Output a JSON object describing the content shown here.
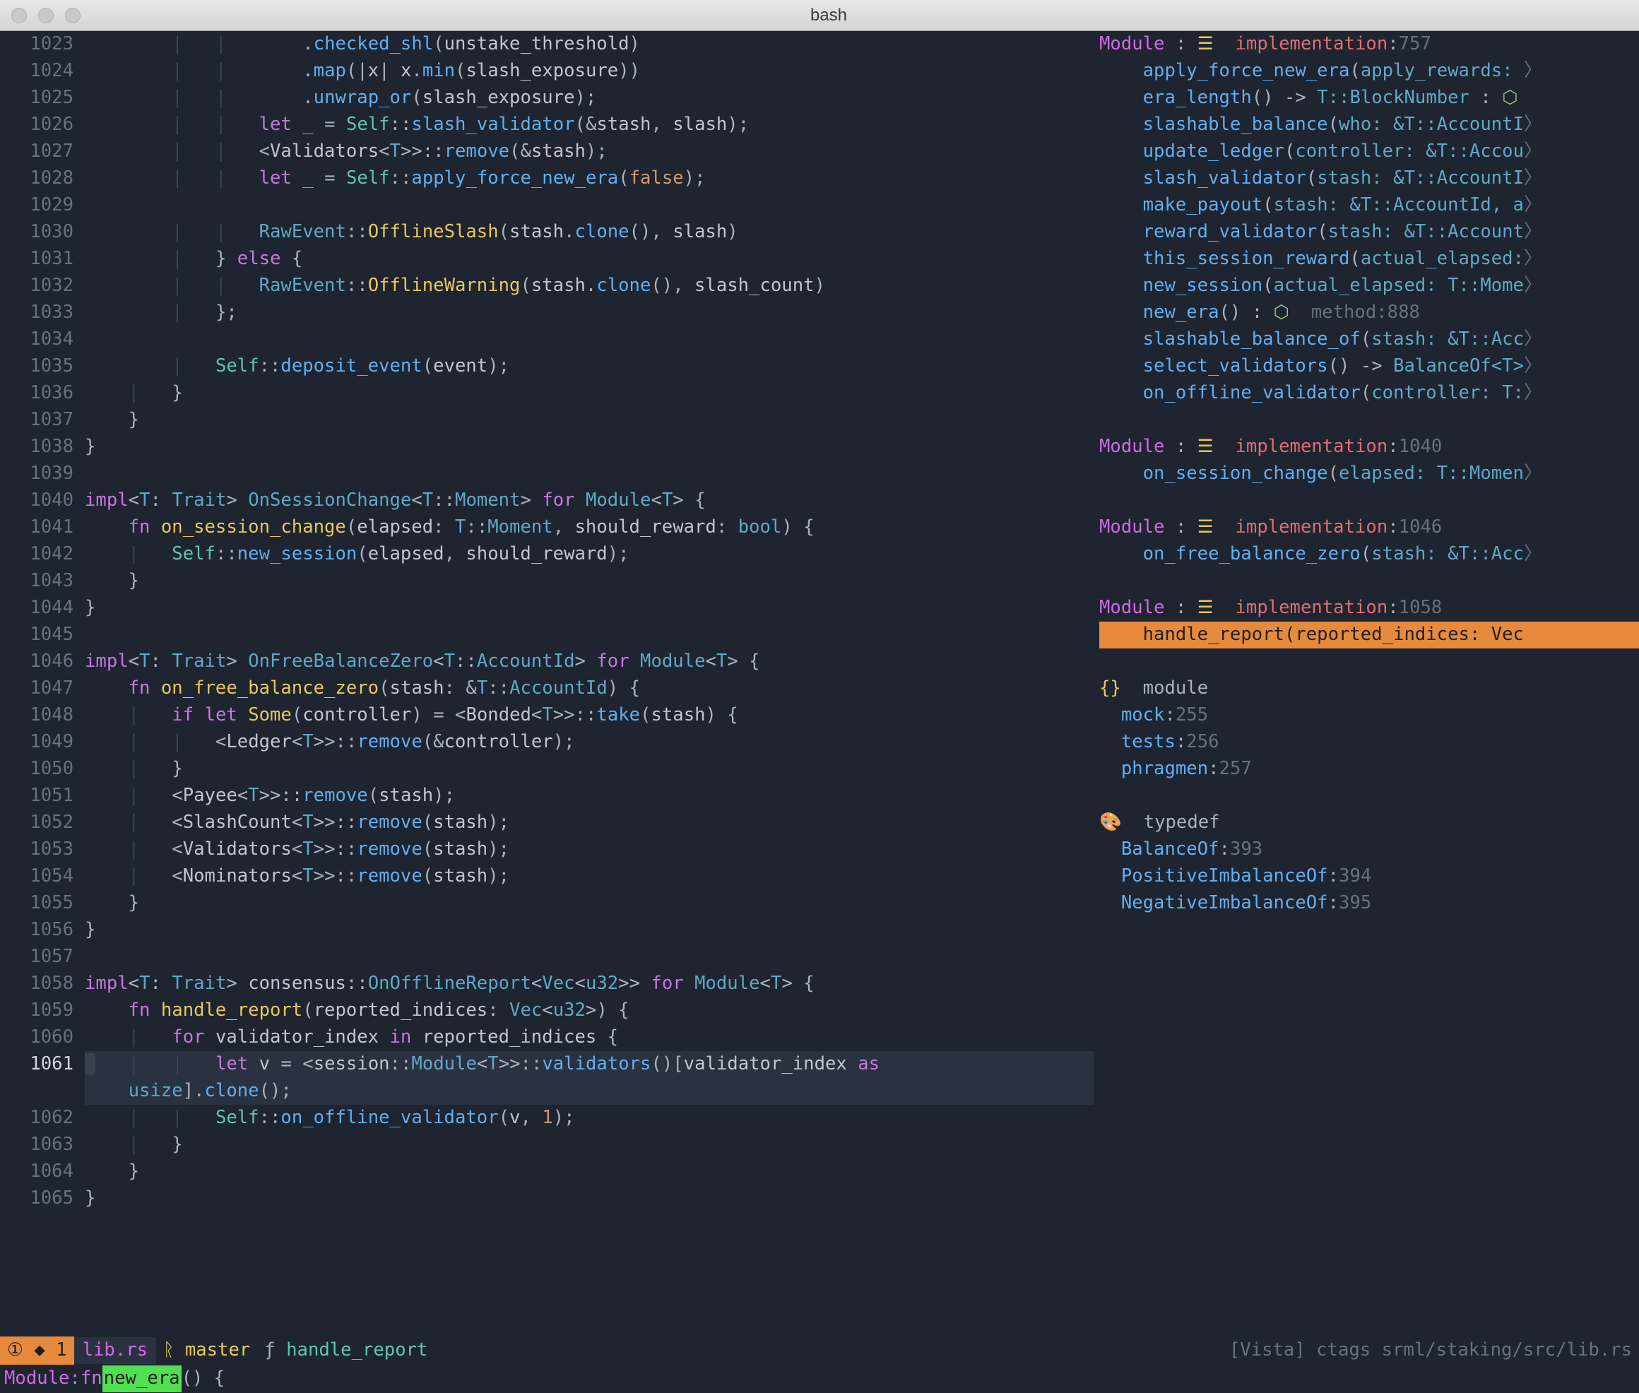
{
  "window": {
    "title": "bash"
  },
  "editor": {
    "current_line": 1061,
    "lines": [
      {
        "n": 1023,
        "html": "        <span class='pipe'>|</span>   <span class='pipe'>|</span>       <span class='pn'>.</span><span class='call'>checked_shl</span><span class='pn'>(</span>unstake_threshold<span class='pn'>)</span>"
      },
      {
        "n": 1024,
        "html": "        <span class='pipe'>|</span>   <span class='pipe'>|</span>       <span class='pn'>.</span><span class='call'>map</span><span class='pn'>(|</span>x<span class='pn'>|</span> x<span class='pn'>.</span><span class='call'>min</span><span class='pn'>(</span>slash_exposure<span class='pn'>))</span>"
      },
      {
        "n": 1025,
        "html": "        <span class='pipe'>|</span>   <span class='pipe'>|</span>       <span class='pn'>.</span><span class='call'>unwrap_or</span><span class='pn'>(</span>slash_exposure<span class='pn'>);</span>"
      },
      {
        "n": 1026,
        "html": "        <span class='pipe'>|</span>   <span class='pipe'>|</span>   <span class='kw'>let</span> <span class='kw'>_</span> <span class='op'>=</span> <span class='self'>Self</span><span class='pn'>::</span><span class='call'>slash_validator</span><span class='pn'>(&</span>stash<span class='pn'>,</span> slash<span class='pn'>);</span>"
      },
      {
        "n": 1027,
        "html": "        <span class='pipe'>|</span>   <span class='pipe'>|</span>   <span class='pn'>&lt;</span>Validators<span class='pn'>&lt;</span><span class='ty'>T</span><span class='pn'>&gt;&gt;::</span><span class='call'>remove</span><span class='pn'>(&</span>stash<span class='pn'>);</span>"
      },
      {
        "n": 1028,
        "html": "        <span class='pipe'>|</span>   <span class='pipe'>|</span>   <span class='kw'>let</span> <span class='kw'>_</span> <span class='op'>=</span> <span class='self'>Self</span><span class='pn'>::</span><span class='call'>apply_force_new_era</span><span class='pn'>(</span><span class='num'>false</span><span class='pn'>);</span>"
      },
      {
        "n": 1029,
        "html": ""
      },
      {
        "n": 1030,
        "html": "        <span class='pipe'>|</span>   <span class='pipe'>|</span>   <span class='ty'>RawEvent</span><span class='pn'>::</span><span class='fn'>OfflineSlash</span><span class='pn'>(</span>stash<span class='pn'>.</span><span class='call'>clone</span><span class='pn'>(),</span> slash<span class='pn'>)</span>"
      },
      {
        "n": 1031,
        "html": "        <span class='pipe'>|</span>   <span class='pn'>}</span> <span class='kw'>else</span> <span class='pn'>{</span>"
      },
      {
        "n": 1032,
        "html": "        <span class='pipe'>|</span>   <span class='pipe'>|</span>   <span class='ty'>RawEvent</span><span class='pn'>::</span><span class='fn'>OfflineWarning</span><span class='pn'>(</span>stash<span class='pn'>.</span><span class='call'>clone</span><span class='pn'>(),</span> slash_count<span class='pn'>)</span>"
      },
      {
        "n": 1033,
        "html": "        <span class='pipe'>|</span>   <span class='pn'>};</span>"
      },
      {
        "n": 1034,
        "html": ""
      },
      {
        "n": 1035,
        "html": "        <span class='pipe'>|</span>   <span class='self'>Self</span><span class='pn'>::</span><span class='call'>deposit_event</span><span class='pn'>(</span>event<span class='pn'>);</span>"
      },
      {
        "n": 1036,
        "html": "    <span class='pipe'>|</span>   <span class='pn'>}</span>"
      },
      {
        "n": 1037,
        "html": "    <span class='pn'>}</span>"
      },
      {
        "n": 1038,
        "html": "<span class='pn'>}</span>"
      },
      {
        "n": 1039,
        "html": ""
      },
      {
        "n": 1040,
        "html": "<span class='kw'>impl</span><span class='pn'>&lt;</span><span class='ty'>T</span><span class='pn'>:</span> <span class='ty'>Trait</span><span class='pn'>&gt;</span> <span class='ty'>OnSessionChange</span><span class='pn'>&lt;</span><span class='ty'>T</span><span class='pn'>::</span><span class='ty'>Moment</span><span class='pn'>&gt;</span> <span class='kw'>for</span> <span class='ty'>Module</span><span class='pn'>&lt;</span><span class='ty'>T</span><span class='pn'>&gt;</span> <span class='pn'>{</span>"
      },
      {
        "n": 1041,
        "html": "    <span class='kw'>fn</span> <span class='fn'>on_session_change</span><span class='pn'>(</span>elapsed<span class='pn'>:</span> <span class='ty'>T</span><span class='pn'>::</span><span class='ty'>Moment</span><span class='pn'>,</span> should_reward<span class='pn'>:</span> <span class='ty'>bool</span><span class='pn'>)</span> <span class='pn'>{</span>"
      },
      {
        "n": 1042,
        "html": "    <span class='pipe'>|</span>   <span class='self'>Self</span><span class='pn'>::</span><span class='call'>new_session</span><span class='pn'>(</span>elapsed<span class='pn'>,</span> should_reward<span class='pn'>);</span>"
      },
      {
        "n": 1043,
        "html": "    <span class='pn'>}</span>"
      },
      {
        "n": 1044,
        "html": "<span class='pn'>}</span>"
      },
      {
        "n": 1045,
        "html": ""
      },
      {
        "n": 1046,
        "html": "<span class='kw'>impl</span><span class='pn'>&lt;</span><span class='ty'>T</span><span class='pn'>:</span> <span class='ty'>Trait</span><span class='pn'>&gt;</span> <span class='ty'>OnFreeBalanceZero</span><span class='pn'>&lt;</span><span class='ty'>T</span><span class='pn'>::</span><span class='ty'>AccountId</span><span class='pn'>&gt;</span> <span class='kw'>for</span> <span class='ty'>Module</span><span class='pn'>&lt;</span><span class='ty'>T</span><span class='pn'>&gt;</span> <span class='pn'>{</span>"
      },
      {
        "n": 1047,
        "html": "    <span class='kw'>fn</span> <span class='fn'>on_free_balance_zero</span><span class='pn'>(</span>stash<span class='pn'>:</span> <span class='pn'>&</span><span class='ty'>T</span><span class='pn'>::</span><span class='ty'>AccountId</span><span class='pn'>)</span> <span class='pn'>{</span>"
      },
      {
        "n": 1048,
        "html": "    <span class='pipe'>|</span>   <span class='kw'>if</span> <span class='kw'>let</span> <span class='fn'>Some</span><span class='pn'>(</span>controller<span class='pn'>)</span> <span class='op'>=</span> <span class='pn'>&lt;</span>Bonded<span class='pn'>&lt;</span><span class='ty'>T</span><span class='pn'>&gt;&gt;::</span><span class='call'>take</span><span class='pn'>(</span>stash<span class='pn'>)</span> <span class='pn'>{</span>"
      },
      {
        "n": 1049,
        "html": "    <span class='pipe'>|</span>   <span class='pipe'>|</span>   <span class='pn'>&lt;</span>Ledger<span class='pn'>&lt;</span><span class='ty'>T</span><span class='pn'>&gt;&gt;::</span><span class='call'>remove</span><span class='pn'>(&</span>controller<span class='pn'>);</span>"
      },
      {
        "n": 1050,
        "html": "    <span class='pipe'>|</span>   <span class='pn'>}</span>"
      },
      {
        "n": 1051,
        "html": "    <span class='pipe'>|</span>   <span class='pn'>&lt;</span>Payee<span class='pn'>&lt;</span><span class='ty'>T</span><span class='pn'>&gt;&gt;::</span><span class='call'>remove</span><span class='pn'>(</span>stash<span class='pn'>);</span>"
      },
      {
        "n": 1052,
        "html": "    <span class='pipe'>|</span>   <span class='pn'>&lt;</span>SlashCount<span class='pn'>&lt;</span><span class='ty'>T</span><span class='pn'>&gt;&gt;::</span><span class='call'>remove</span><span class='pn'>(</span>stash<span class='pn'>);</span>"
      },
      {
        "n": 1053,
        "html": "    <span class='pipe'>|</span>   <span class='pn'>&lt;</span>Validators<span class='pn'>&lt;</span><span class='ty'>T</span><span class='pn'>&gt;&gt;::</span><span class='call'>remove</span><span class='pn'>(</span>stash<span class='pn'>);</span>"
      },
      {
        "n": 1054,
        "html": "    <span class='pipe'>|</span>   <span class='pn'>&lt;</span>Nominators<span class='pn'>&lt;</span><span class='ty'>T</span><span class='pn'>&gt;&gt;::</span><span class='call'>remove</span><span class='pn'>(</span>stash<span class='pn'>);</span>"
      },
      {
        "n": 1055,
        "html": "    <span class='pn'>}</span>"
      },
      {
        "n": 1056,
        "html": "<span class='pn'>}</span>"
      },
      {
        "n": 1057,
        "html": ""
      },
      {
        "n": 1058,
        "html": "<span class='kw'>impl</span><span class='pn'>&lt;</span><span class='ty'>T</span><span class='pn'>:</span> <span class='ty'>Trait</span><span class='pn'>&gt;</span> consensus<span class='pn'>::</span><span class='ty'>OnOfflineReport</span><span class='pn'>&lt;</span><span class='ty'>Vec</span><span class='pn'>&lt;</span><span class='ty'>u32</span><span class='pn'>&gt;&gt;</span> <span class='kw'>for</span> <span class='ty'>Module</span><span class='pn'>&lt;</span><span class='ty'>T</span><span class='pn'>&gt;</span> <span class='pn'>{</span>"
      },
      {
        "n": 1059,
        "html": "    <span class='kw'>fn</span> <span class='fn'>handle_report</span><span class='pn'>(</span>reported_indices<span class='pn'>:</span> <span class='ty'>Vec</span><span class='pn'>&lt;</span><span class='ty'>u32</span><span class='pn'>&gt;)</span> <span class='pn'>{</span>"
      },
      {
        "n": 1060,
        "html": "    <span class='pipe'>|</span>   <span class='kw'>for</span> validator_index <span class='kw'>in</span> reported_indices <span class='pn'>{</span>"
      },
      {
        "n": 1061,
        "html": "<span style='background:#3a4150;'> </span>   <span class='pipe'>|</span>   <span class='pipe'>|</span>   <span class='kw'>let</span> v <span class='op'>=</span> <span class='pn'>&lt;</span>session<span class='pn'>::</span><span class='ty'>Module</span><span class='pn'>&lt;</span><span class='ty'>T</span><span class='pn'>&gt;&gt;::</span><span class='call'>validators</span><span class='pn'>()[</span>validator_index <span class='kw'>as</span>",
        "hl": true
      },
      {
        "n": 0,
        "html": "    <span class='ty'>usize</span><span class='pn'>].</span><span class='call'>clone</span><span class='pn'>();</span>",
        "hl": true,
        "hide_ln": true
      },
      {
        "n": 1062,
        "html": "    <span class='pipe'>|</span>   <span class='pipe'>|</span>   <span class='self'>Self</span><span class='pn'>::</span><span class='call'>on_offline_validator</span><span class='pn'>(</span>v<span class='pn'>,</span> <span class='num'>1</span><span class='pn'>);</span>"
      },
      {
        "n": 1063,
        "html": "    <span class='pipe'>|</span>   <span class='pn'>}</span>"
      },
      {
        "n": 1064,
        "html": "    <span class='pn'>}</span>"
      },
      {
        "n": 1065,
        "html": "<span class='pn'>}</span>"
      }
    ]
  },
  "outline": {
    "groups": [
      {
        "header_html": "<span class='mg'>Module</span> <span class='pn'>:</span> <span class='fn'>☰</span>  <span class='red'>implementation</span><span class='pn'>:</span><span class='cm'>757</span>",
        "items": [
          {
            "html": "    <span class='call'>apply_force_new_era</span><span class='pn'>(</span><span class='ty'>apply_rewards:</span> <span class='cm'>〉</span>"
          },
          {
            "html": "    <span class='call'>era_length</span><span class='pn'>()</span> <span class='pn'>-&gt;</span> <span class='ty'>T::BlockNumber</span> <span class='pn'>:</span> <span class='green2'>⬡</span>"
          },
          {
            "html": "    <span class='call'>slashable_balance</span><span class='pn'>(</span><span class='ty'>who: &T::AccountI</span><span class='cm'>〉</span>"
          },
          {
            "html": "    <span class='call'>update_ledger</span><span class='pn'>(</span><span class='ty'>controller: &T::Accou</span><span class='cm'>〉</span>"
          },
          {
            "html": "    <span class='call'>slash_validator</span><span class='pn'>(</span><span class='ty'>stash: &T::AccountI</span><span class='cm'>〉</span>"
          },
          {
            "html": "    <span class='call'>make_payout</span><span class='pn'>(</span><span class='ty'>stash: &T::AccountId, a</span><span class='cm'>〉</span>"
          },
          {
            "html": "    <span class='call'>reward_validator</span><span class='pn'>(</span><span class='ty'>stash: &T::Account</span><span class='cm'>〉</span>"
          },
          {
            "html": "    <span class='call'>this_session_reward</span><span class='pn'>(</span><span class='ty'>actual_elapsed:</span><span class='cm'>〉</span>"
          },
          {
            "html": "    <span class='call'>new_session</span><span class='pn'>(</span><span class='ty'>actual_elapsed: T::Mome</span><span class='cm'>〉</span>"
          },
          {
            "html": "    <span class='call'>new_era</span><span class='pn'>()</span> <span class='pn'>:</span> <span class='green2'>⬡</span>  <span class='cm'>method:</span><span class='cm'>888</span>"
          },
          {
            "html": "    <span class='call'>slashable_balance_of</span><span class='pn'>(</span><span class='ty'>stash: &T::Acc</span><span class='cm'>〉</span>"
          },
          {
            "html": "    <span class='call'>select_validators</span><span class='pn'>()</span> <span class='pn'>-&gt;</span> <span class='ty'>BalanceOf&lt;T&gt;</span><span class='cm'>〉</span>"
          },
          {
            "html": "    <span class='call'>on_offline_validator</span><span class='pn'>(</span><span class='ty'>controller: T:</span><span class='cm'>〉</span>"
          }
        ]
      },
      {
        "header_html": "<span class='mg'>Module</span> <span class='pn'>:</span> <span class='fn'>☰</span>  <span class='red'>implementation</span><span class='pn'>:</span><span class='cm'>1040</span>",
        "items": [
          {
            "html": "    <span class='call'>on_session_change</span><span class='pn'>(</span><span class='ty'>elapsed: T::Momen</span><span class='cm'>〉</span>"
          }
        ]
      },
      {
        "header_html": "<span class='mg'>Module</span> <span class='pn'>:</span> <span class='fn'>☰</span>  <span class='red'>implementation</span><span class='pn'>:</span><span class='cm'>1046</span>",
        "items": [
          {
            "html": "    <span class='call'>on_free_balance_zero</span><span class='pn'>(</span><span class='ty'>stash: &T::Acc</span><span class='cm'>〉</span>"
          }
        ]
      },
      {
        "header_html": "<span class='mg'>Module</span> <span class='pn'>:</span> <span class='fn'>☰</span>  <span class='red'>implementation</span><span class='pn'>:</span><span class='cm'>1058</span>",
        "items": [
          {
            "html": "    handle_report(reported_indices: Vec",
            "selected": true
          }
        ]
      },
      {
        "header_html": "<span class='fn'>{}</span>  <span class='op'>module</span>",
        "items": [
          {
            "html": "  <span class='call'>mock</span><span class='pn'>:</span><span class='cm'>255</span>"
          },
          {
            "html": "  <span class='call'>tests</span><span class='pn'>:</span><span class='cm'>256</span>"
          },
          {
            "html": "  <span class='call'>phragmen</span><span class='pn'>:</span><span class='cm'>257</span>"
          }
        ]
      },
      {
        "header_html": "<span class='fn'>🎨</span>  <span class='op'>typedef</span>",
        "items": [
          {
            "html": "  <span class='call'>BalanceOf</span><span class='pn'>:</span><span class='cm'>393</span>"
          },
          {
            "html": "  <span class='call'>PositiveImbalanceOf</span><span class='pn'>:</span><span class='cm'>394</span>"
          },
          {
            "html": "  <span class='call'>NegativeImbalanceOf</span><span class='pn'>:</span><span class='cm'>395</span>"
          }
        ]
      }
    ]
  },
  "status": {
    "badge": "① ◆ 1",
    "file": "lib.rs",
    "branch_icon": "ᚱ",
    "branch": "master",
    "func_icon": "ƒ",
    "func": "handle_report",
    "right": "[Vista] ctags srml/staking/src/lib.rs",
    "line2_prefix": "Module:  ",
    "line2_kw": "fn ",
    "line2_hl": "new_era",
    "line2_suffix": "() {"
  }
}
